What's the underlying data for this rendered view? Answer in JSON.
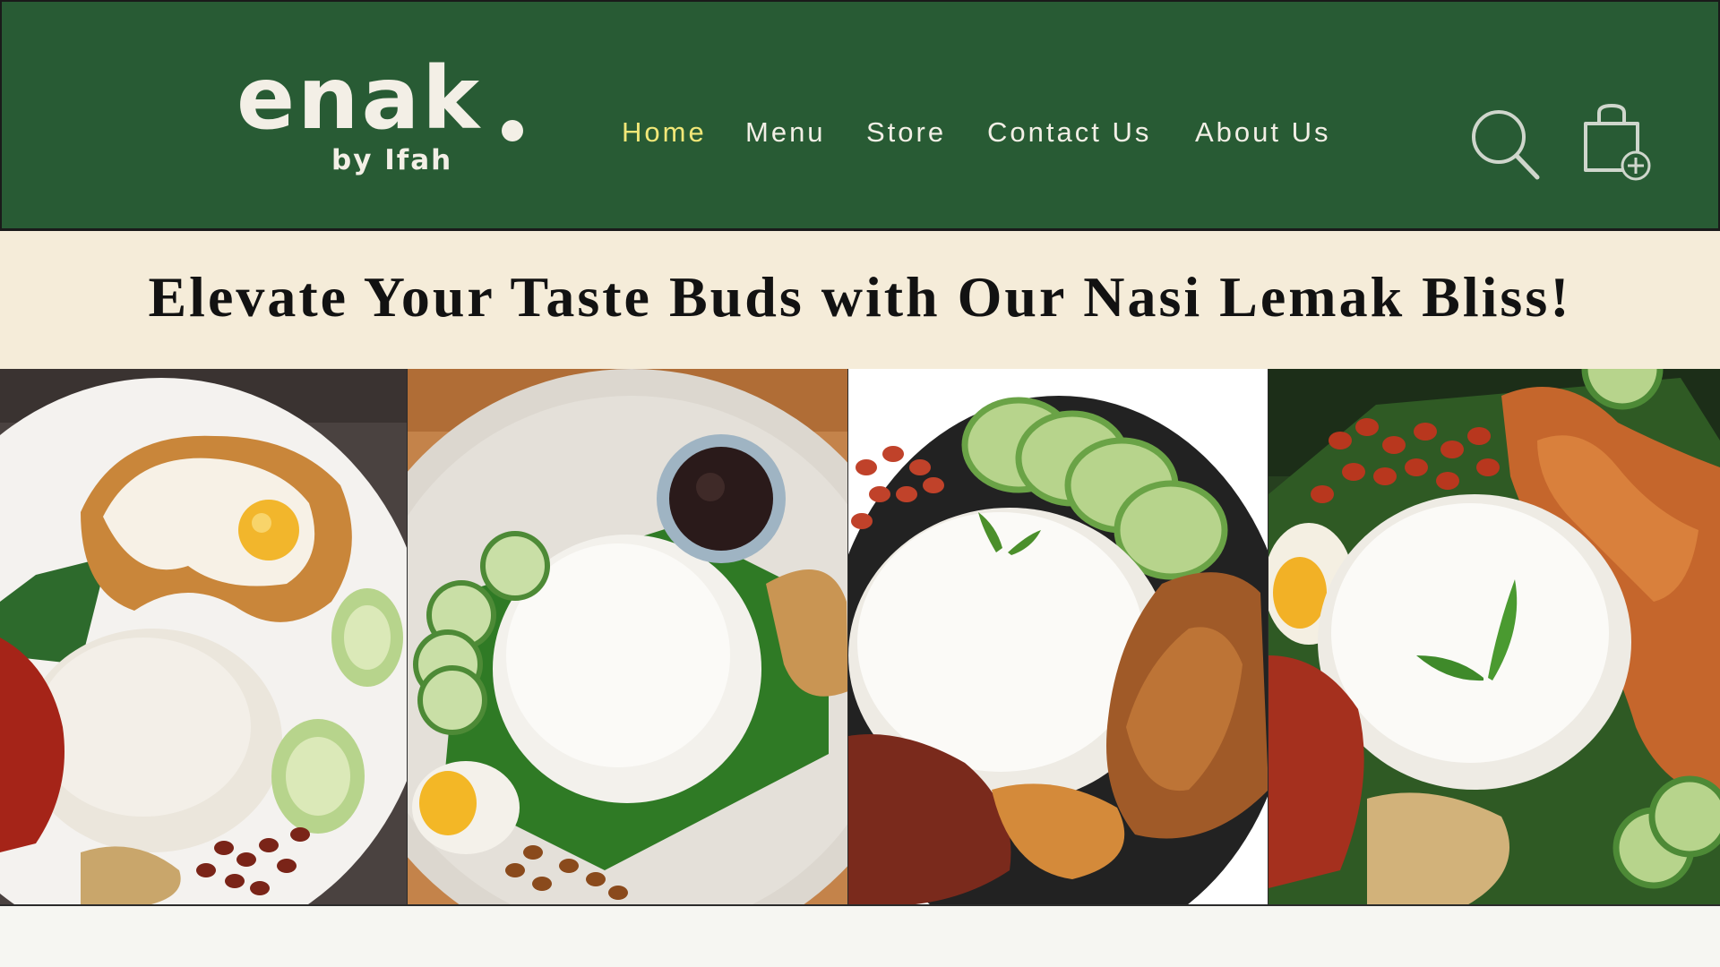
{
  "brand": {
    "name": "enak",
    "tagline": "by Ifah"
  },
  "nav": {
    "items": [
      {
        "label": "Home",
        "active": true
      },
      {
        "label": "Menu",
        "active": false
      },
      {
        "label": "Store",
        "active": false
      },
      {
        "label": "Contact Us",
        "active": false
      },
      {
        "label": "About Us",
        "active": false
      }
    ]
  },
  "icons": {
    "search": "search-icon",
    "cart": "shopping-bag-add-icon"
  },
  "hero": {
    "headline": "Elevate Your Taste Buds with Our Nasi Lemak Bliss!"
  },
  "colors": {
    "header_bg": "#285b34",
    "nav_text": "#f3efe6",
    "nav_active": "#f1e778",
    "tagline_bg": "#f5ecd9",
    "page_bg": "#f6f6f2"
  }
}
